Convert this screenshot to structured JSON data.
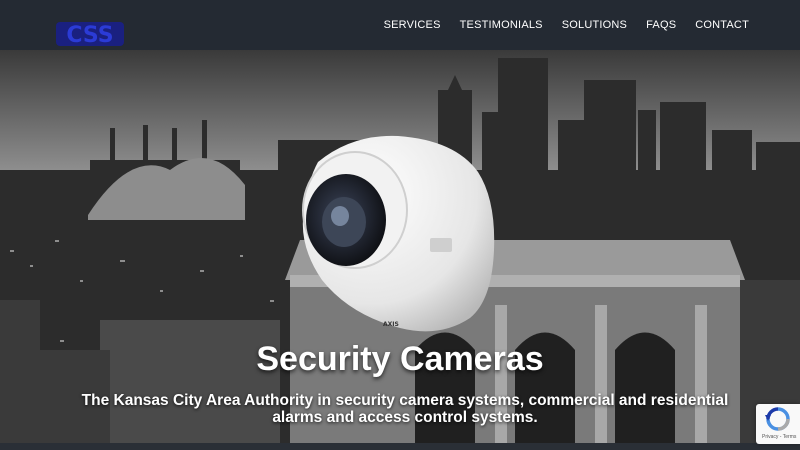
{
  "header": {
    "logo_text": "CSS",
    "nav": [
      "SERVICES",
      "TESTIMONIALS",
      "SOLUTIONS",
      "FAQS",
      "CONTACT"
    ]
  },
  "hero": {
    "title": "Security Cameras",
    "subtitle": "The Kansas City Area Authority in security camera systems, commercial and residential alarms and access control systems.",
    "camera_brand": "AXIS"
  },
  "recaptcha": {
    "links": "Privacy - Terms"
  },
  "colors": {
    "header_bg": "#242a33",
    "logo": "#1f2aa8",
    "text": "#ffffff"
  }
}
